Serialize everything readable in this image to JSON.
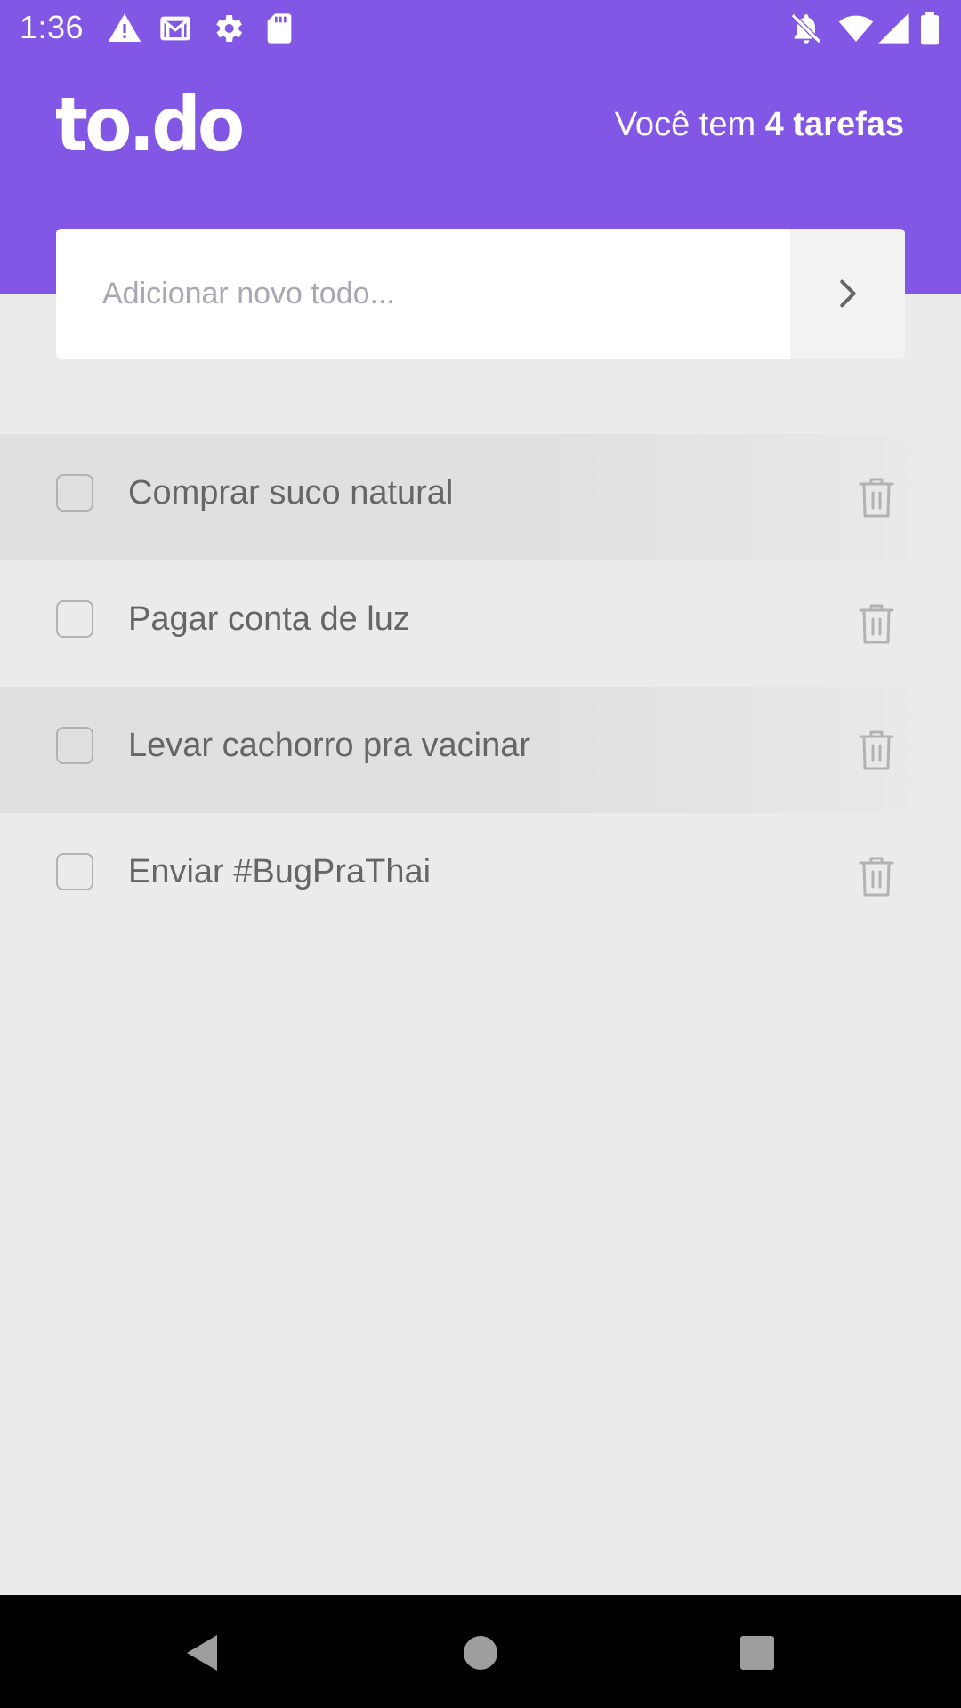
{
  "status_bar": {
    "time": "1:36",
    "left_icons": [
      "warning-icon",
      "gmail-icon",
      "gear-icon",
      "sd-card-icon"
    ],
    "right_icons": [
      "notifications-off-icon",
      "wifi-icon",
      "cell-signal-icon",
      "battery-icon"
    ]
  },
  "header": {
    "logo": "to.do",
    "count_prefix": "Você tem ",
    "count_bold": "4 tarefas"
  },
  "new_todo": {
    "placeholder": "Adicionar novo todo...",
    "value": "",
    "submit_icon": "chevron-right-icon"
  },
  "tasks": [
    {
      "title": "Comprar suco natural",
      "done": false
    },
    {
      "title": "Pagar conta de luz",
      "done": false
    },
    {
      "title": "Levar cachorro pra vacinar",
      "done": false
    },
    {
      "title": "Enviar #BugPraThai",
      "done": false
    }
  ],
  "nav_bar": {
    "buttons": [
      "back-icon",
      "home-icon",
      "recents-icon"
    ]
  },
  "colors": {
    "brand": "#8257E5",
    "background": "#EBEBEB",
    "task_text": "#666666",
    "icon_gray": "#B2B2B2",
    "placeholder": "#A8A8B3"
  }
}
